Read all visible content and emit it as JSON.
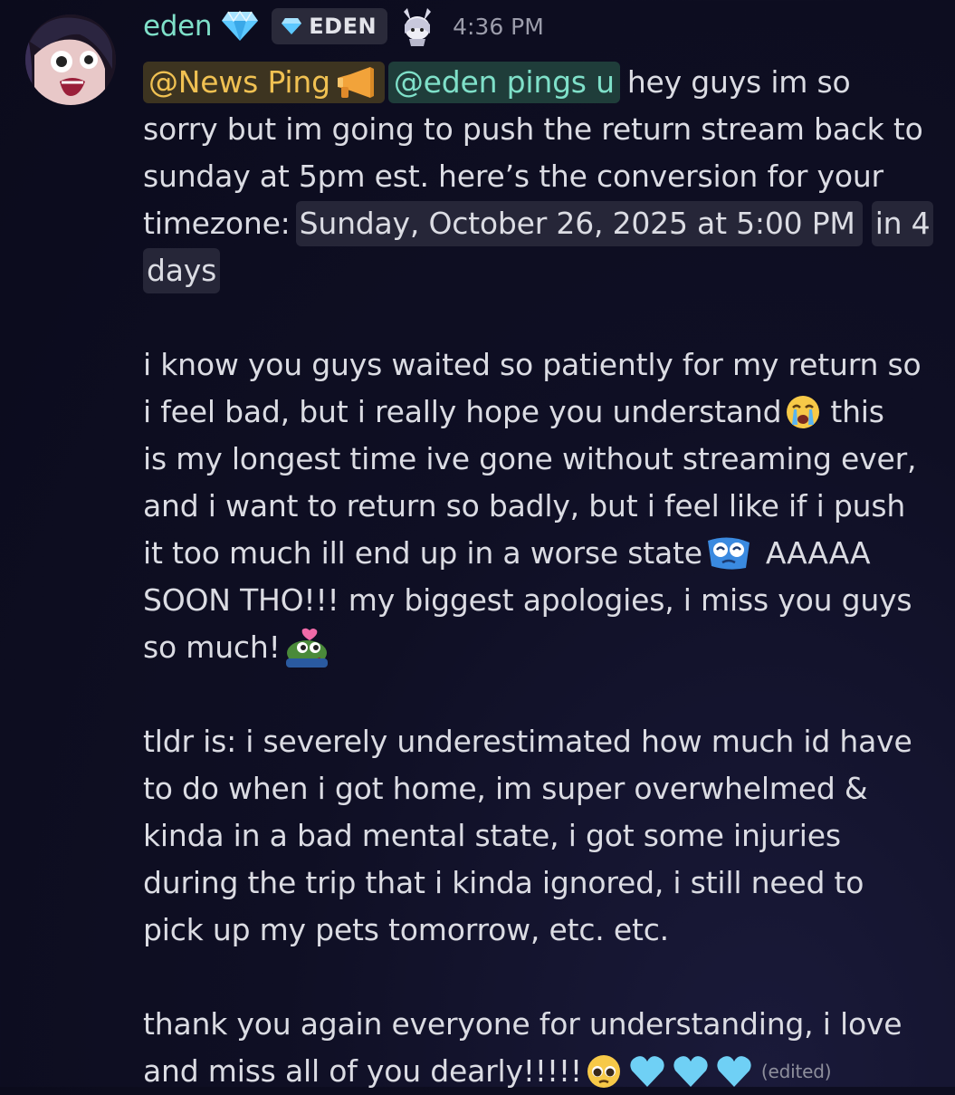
{
  "author": {
    "name": "eden",
    "role_tag": "EDEN",
    "timestamp": "4:36 PM"
  },
  "message": {
    "mention_1": "@News Ping",
    "mention_2": "@eden pings u",
    "line1_text": "hey guys im so",
    "line2": "sorry but im going to push the return stream back to",
    "line3": "sunday at 5pm est. here’s the conversion for your",
    "line4_prefix": "timezone:",
    "timestamp_chip": "Sunday, October 26, 2025 at 5:00 PM",
    "relative_chip_a": "in 4",
    "relative_chip_b": "days",
    "para2_line1": "i know you guys waited so patiently for my return so",
    "para2_line2a": "i feel bad, but i really hope you understand",
    "para2_line2b": "this",
    "para2_line3": "is my longest time ive gone without streaming ever,",
    "para2_line4": "and i want to return so badly, but i feel like if i push",
    "para2_line5a": "it too much ill end up in a worse state",
    "para2_line5b": "AAAAA",
    "para2_line6": "SOON THO!!! my biggest apologies, i miss you guys",
    "para2_line7": "so much!",
    "para3_line1": "tldr is: i severely underestimated how much id have",
    "para3_line2": "to do when i got home, im super overwhelmed &",
    "para3_line3": "kinda in a bad mental state, i got some injuries",
    "para3_line4": "during the trip that i kinda ignored, i still need to",
    "para3_line5": "pick up my pets tomorrow, etc. etc.",
    "para4_line1": "thank you again everyone for understanding, i love",
    "para4_line2": "and miss all of you dearly!!!!!",
    "edited_label": "(edited)"
  },
  "icons": {
    "gem": "gem-emoji-icon",
    "tag_gem": "gem-icon",
    "megaphone": "megaphone-emoji-icon",
    "crying": "crying-face-emoji-icon",
    "distressed": "distressed-custom-emoji-icon",
    "frog": "peepo-heart-custom-emoji-icon",
    "pleading": "pleading-face-emoji-icon",
    "heart": "light-blue-heart-emoji-icon"
  },
  "colors": {
    "username": "#7fe0c9",
    "mention_role1": "#f0c152",
    "mention_role2": "#7fe0c9",
    "text": "#dbdce3",
    "timestamp": "#9c9dab"
  }
}
